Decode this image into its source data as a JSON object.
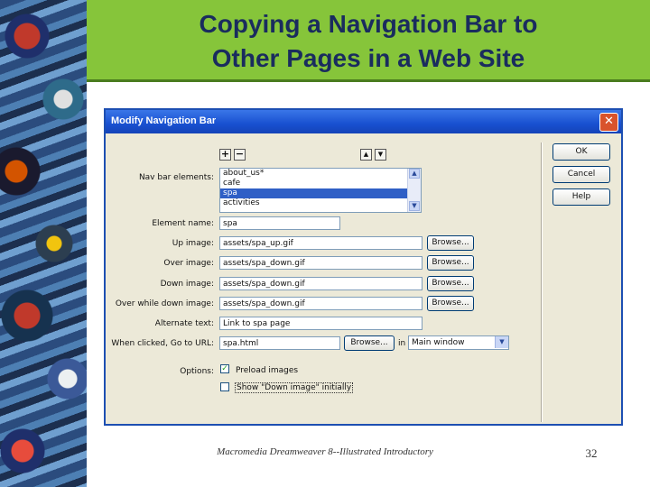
{
  "slide": {
    "title_line1": "Copying a Navigation Bar to",
    "title_line2": "Other Pages in a Web Site",
    "footer": "Macromedia Dreamweaver 8--Illustrated Introductory",
    "page_number": "32"
  },
  "dialog": {
    "title": "Modify Navigation Bar",
    "close_glyph": "✕",
    "add_glyph": "+",
    "remove_glyph": "−",
    "up_glyph": "▲",
    "down_glyph": "▼",
    "nav_elements_label": "Nav bar elements:",
    "nav_elements": [
      "about_us*",
      "cafe",
      "spa",
      "activities"
    ],
    "selected_element": "spa",
    "element_name_label": "Element name:",
    "element_name_value": "spa",
    "up_image_label": "Up image:",
    "up_image_value": "assets/spa_up.gif",
    "over_image_label": "Over image:",
    "over_image_value": "assets/spa_down.gif",
    "down_image_label": "Down image:",
    "down_image_value": "assets/spa_down.gif",
    "over_while_down_label": "Over while down image:",
    "over_while_down_value": "assets/spa_down.gif",
    "alt_text_label": "Alternate text:",
    "alt_text_value": "Link to spa page",
    "when_clicked_label": "When clicked, Go to URL:",
    "when_clicked_value": "spa.html",
    "browse_label": "Browse...",
    "in_label": "in",
    "target_value": "Main window",
    "options_label": "Options:",
    "preload_label": "Preload images",
    "preload_checked": true,
    "show_down_label": "Show \"Down image\" initially",
    "show_down_checked": false,
    "ok_label": "OK",
    "cancel_label": "Cancel",
    "help_label": "Help"
  },
  "colors": {
    "title_color": "#1a2c5e",
    "header_band": "#86c53a",
    "dialog_titlebar": "#1850d0"
  }
}
